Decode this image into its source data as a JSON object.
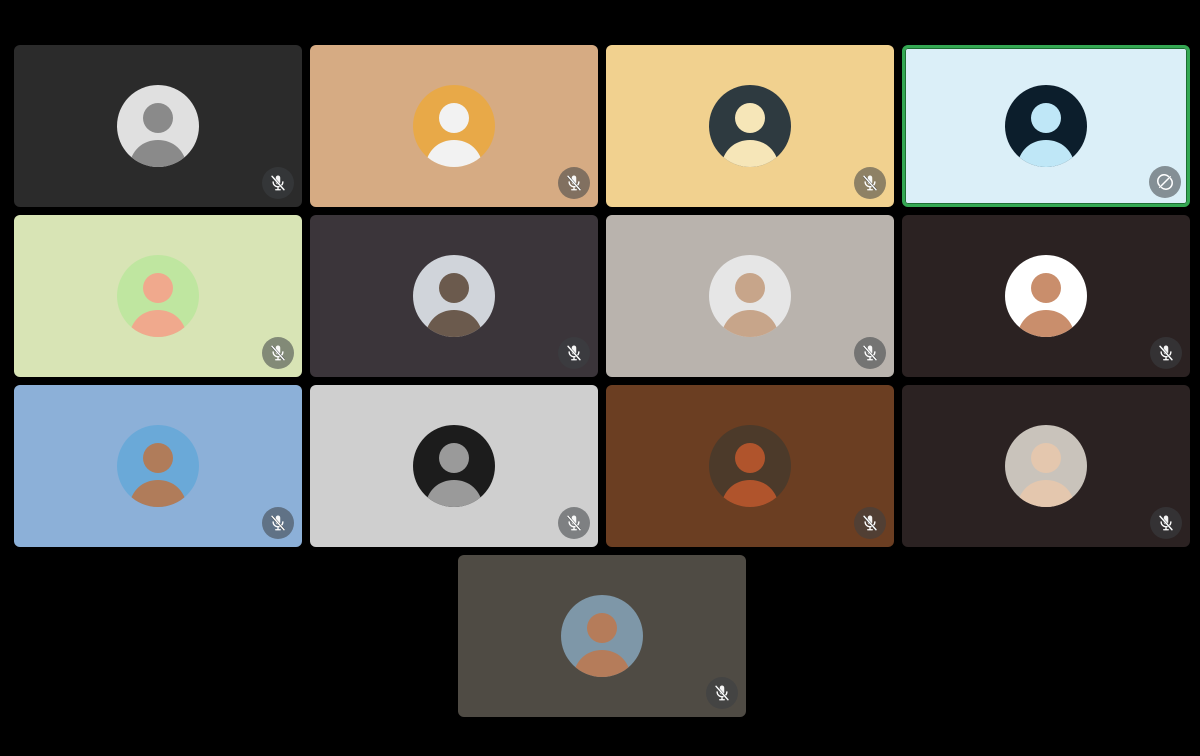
{
  "participants": [
    {
      "bg": "#2b2b2b",
      "status": "mic-off-icon",
      "avatar_tone": "#8a8a8a",
      "avatar_bg": "#e0e0e0"
    },
    {
      "bg": "#d6ab83",
      "status": "mic-off-icon",
      "avatar_tone": "#f2f2f2",
      "avatar_bg": "#e8a948"
    },
    {
      "bg": "#f1d18f",
      "status": "mic-off-icon",
      "avatar_tone": "#f6e6b8",
      "avatar_bg": "#2e3a40"
    },
    {
      "bg": "#dbeff8",
      "status": "speaking-icon",
      "avatar_tone": "#bfe7f7",
      "avatar_bg": "#0c1e2c",
      "speaking": true
    },
    {
      "bg": "#d8e4b5",
      "status": "mic-off-icon",
      "avatar_tone": "#f0a98d",
      "avatar_bg": "#bfe6a0"
    },
    {
      "bg": "#3b353a",
      "status": "mic-off-icon",
      "avatar_tone": "#6b5a4d",
      "avatar_bg": "#d0d4da"
    },
    {
      "bg": "#b9b3ad",
      "status": "mic-off-icon",
      "avatar_tone": "#c7a58a",
      "avatar_bg": "#e6e6e6"
    },
    {
      "bg": "#2b2222",
      "status": "mic-off-icon",
      "avatar_tone": "#c98e6c",
      "avatar_bg": "#ffffff"
    },
    {
      "bg": "#8cb0d8",
      "status": "mic-off-icon",
      "avatar_tone": "#b07c5a",
      "avatar_bg": "#6aa9d8"
    },
    {
      "bg": "#cfcfcf",
      "status": "mic-off-icon",
      "avatar_tone": "#9a9a9a",
      "avatar_bg": "#1c1c1c"
    },
    {
      "bg": "#6b3e22",
      "status": "mic-off-icon",
      "avatar_tone": "#b0542c",
      "avatar_bg": "#4c3a2a"
    },
    {
      "bg": "#2b2222",
      "status": "mic-off-icon",
      "avatar_tone": "#e4c7ae",
      "avatar_bg": "#c9c3bb"
    },
    {
      "bg": "#4f4b44",
      "status": "mic-off-icon",
      "avatar_tone": "#b57c5a",
      "avatar_bg": "#7e97a8"
    }
  ],
  "colors": {
    "page_bg": "#000000",
    "speaking_border": "#34a853",
    "status_icon": "#ffffff"
  }
}
